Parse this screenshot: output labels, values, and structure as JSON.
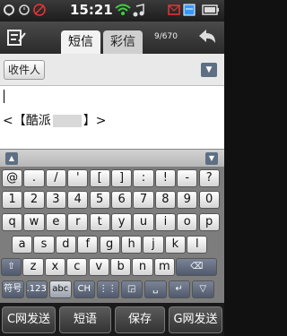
{
  "status_bar": {
    "time": "15:21",
    "icons": [
      "gps-icon",
      "alarm-icon",
      "signal-g-icon",
      "vibrate-off-icon",
      "wifi-icon",
      "music-icon",
      "battery-icon",
      "message-icon",
      "calendar-icon"
    ]
  },
  "header": {
    "tab_sms": "短信",
    "tab_mms": "彩信",
    "counter": "9/670"
  },
  "recipient": {
    "label": "收件人"
  },
  "message": {
    "signature_open": "<【酷派",
    "signature_close": "】>"
  },
  "keyboard": {
    "row1": [
      "@",
      ".",
      "/",
      "'",
      "[",
      "]",
      ":",
      "!",
      "-",
      "?"
    ],
    "row2": [
      "1",
      "2",
      "3",
      "4",
      "5",
      "6",
      "7",
      "8",
      "9",
      "0"
    ],
    "row3": [
      "q",
      "w",
      "e",
      "r",
      "t",
      "y",
      "u",
      "i",
      "o",
      "p"
    ],
    "row4": [
      "a",
      "s",
      "d",
      "f",
      "g",
      "h",
      "j",
      "k",
      "l"
    ],
    "row5": [
      "⇧",
      "z",
      "x",
      "c",
      "v",
      "b",
      "n",
      "m",
      "⌫"
    ],
    "row6": [
      "符号",
      ".123",
      "abc",
      "CH",
      "⋮⋮",
      "◲",
      "␣",
      "↵",
      "▽"
    ]
  },
  "bottom_bar": {
    "c_send": "C网发送",
    "phrases": "短语",
    "save": "保存",
    "g_send": "G网发送"
  },
  "colors": {
    "accent": "#5e6f84",
    "tab_active": "#f2f2f2"
  }
}
